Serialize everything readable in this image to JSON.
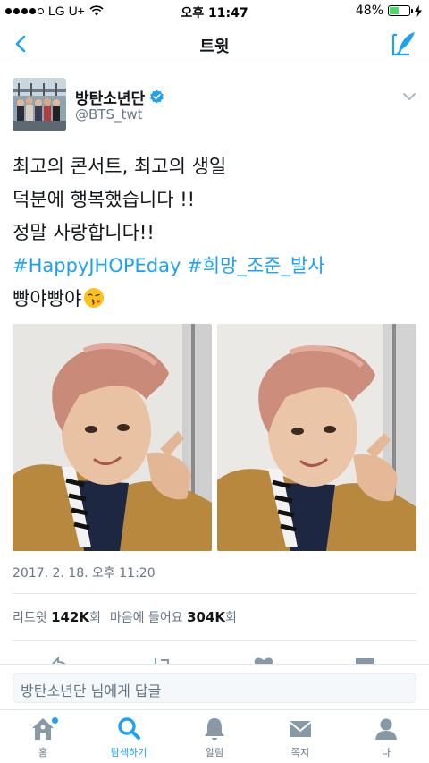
{
  "status_bar": {
    "carrier": "LG U+",
    "time": "오후 11:47",
    "battery": "48%",
    "battery_level": 0.48
  },
  "nav": {
    "title": "트윗"
  },
  "tweet": {
    "author_name": "방탄소년단",
    "author_handle": "@BTS_twt",
    "lines": [
      "최고의 콘서트, 최고의 생일",
      "덕분에 행복했습니다 !!",
      "정말 사랑합니다!!"
    ],
    "hashtags": [
      "#HappyJHOPEday",
      "#희망_조준_발사"
    ],
    "last_line": "빵야빵야",
    "timestamp": "2017. 2. 18. 오후 11:20",
    "stats": {
      "retweet_label": "리트윗",
      "retweet_count": "142K",
      "retweet_unit": "회",
      "like_label": "마음에 들어요",
      "like_count": "304K",
      "like_unit": "회"
    }
  },
  "reply": {
    "placeholder": "방탄소년단 님에게 답글"
  },
  "tabs": [
    {
      "label": "홈",
      "icon": "home-icon"
    },
    {
      "label": "탐색하기",
      "icon": "search-icon"
    },
    {
      "label": "알림",
      "icon": "bell-icon"
    },
    {
      "label": "쪽지",
      "icon": "envelope-icon"
    },
    {
      "label": "나",
      "icon": "person-icon"
    }
  ],
  "colors": {
    "accent": "#1da1f2",
    "text": "#14171a",
    "secondary": "#657786",
    "battery": "#4cd964"
  }
}
